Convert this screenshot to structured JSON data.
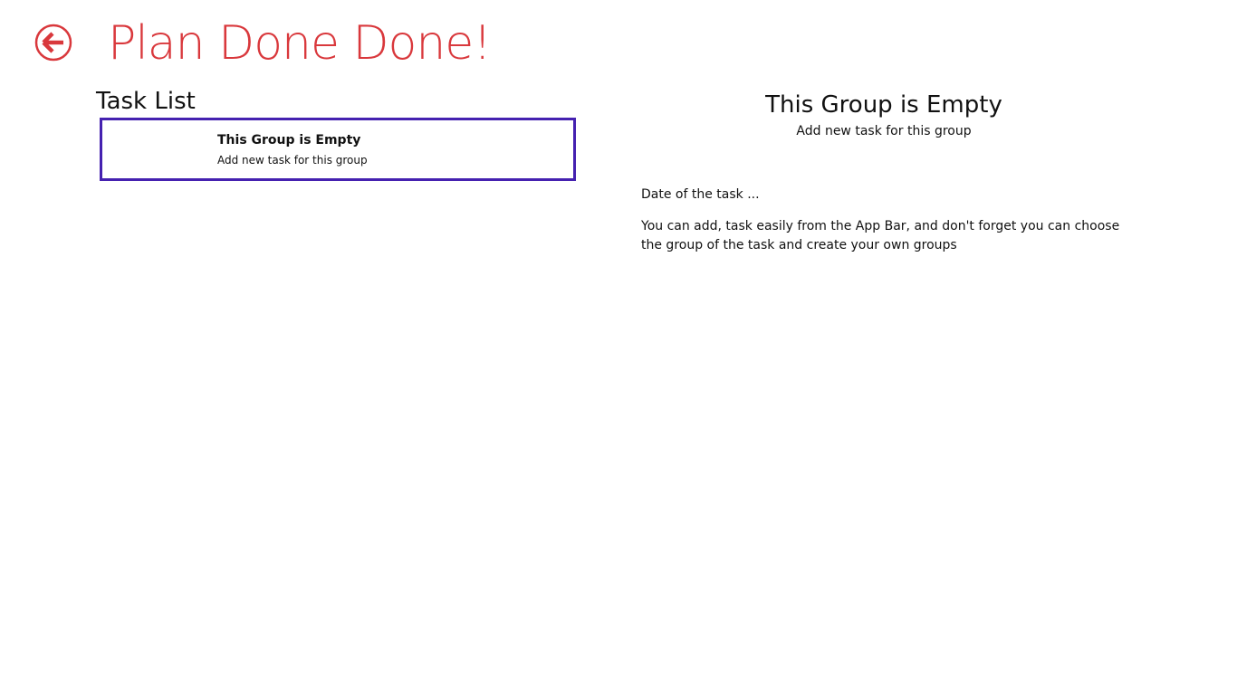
{
  "header": {
    "back_icon": "back-arrow-circle-icon",
    "app_title": "Plan Done Done!"
  },
  "task_list": {
    "title": "Task List",
    "items": [
      {
        "title": "This Group is Empty",
        "subtitle": "Add new task for this group"
      }
    ]
  },
  "detail": {
    "title": "This Group is Empty",
    "subtitle": "Add new task for this group",
    "date": "Date of the task ...",
    "description": "You can add, task easily from the App Bar, and don't forget you can choose the group of the task and create your own groups"
  },
  "colors": {
    "accent": "#d9383c",
    "selection_border": "#4521b0",
    "background": "#ffffff",
    "text": "#111111"
  }
}
